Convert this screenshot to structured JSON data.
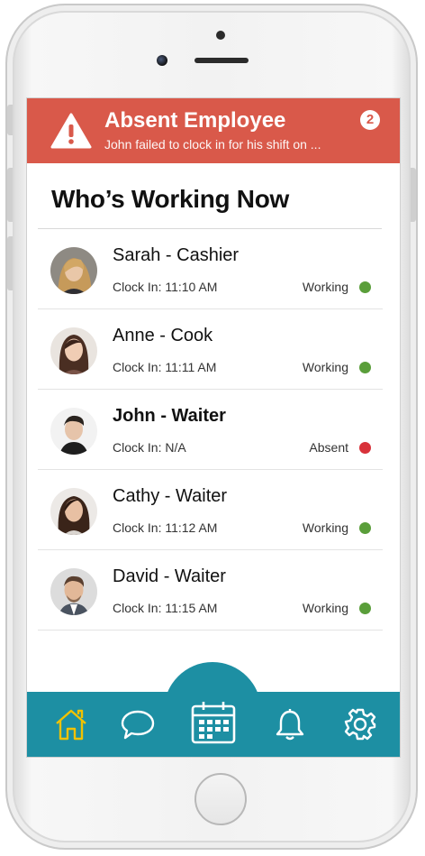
{
  "alert": {
    "title": "Absent Employee",
    "message": "John failed to clock in for his shift on ...",
    "count": "2",
    "color": "#d9594a"
  },
  "page": {
    "title": "Who’s Working Now"
  },
  "employees": [
    {
      "name": "Sarah - Cashier",
      "clock_in": "Clock In: 11:10 AM",
      "status": "Working",
      "status_color": "#5a9e3a"
    },
    {
      "name": "Anne - Cook",
      "clock_in": "Clock In: 11:11 AM",
      "status": "Working",
      "status_color": "#5a9e3a"
    },
    {
      "name": "John - Waiter",
      "clock_in": "Clock In: N/A",
      "status": "Absent",
      "status_color": "#d8323a"
    },
    {
      "name": "Cathy - Waiter",
      "clock_in": "Clock In: 11:12 AM",
      "status": "Working",
      "status_color": "#5a9e3a"
    },
    {
      "name": "David - Waiter",
      "clock_in": "Clock In: 11:15 AM",
      "status": "Working",
      "status_color": "#5a9e3a"
    }
  ],
  "nav": {
    "accent": "#1d8fa3",
    "active_color": "#f2c200",
    "items": [
      "home-icon",
      "chat-icon",
      "calendar-icon",
      "bell-icon",
      "gear-icon"
    ]
  }
}
